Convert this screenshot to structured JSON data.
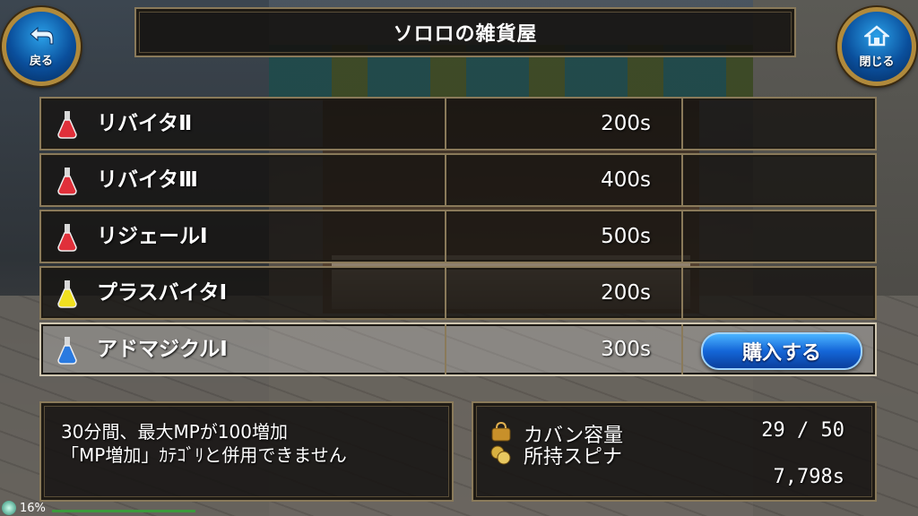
{
  "header": {
    "title": "ソロロの雑貨屋",
    "back_label": "戻る",
    "close_label": "閉じる"
  },
  "items": [
    {
      "name": "リバイタⅡ",
      "price": "200s",
      "potion_color": "#e0303a"
    },
    {
      "name": "リバイタⅢ",
      "price": "400s",
      "potion_color": "#e0303a"
    },
    {
      "name": "リジェールⅠ",
      "price": "500s",
      "potion_color": "#e0303a"
    },
    {
      "name": "プラスバイタⅠ",
      "price": "200s",
      "potion_color": "#f0e020"
    },
    {
      "name": "アドマジクルⅠ",
      "price": "300s",
      "potion_color": "#2a7ae0"
    }
  ],
  "buy_button": {
    "label": "購入する"
  },
  "description": {
    "line1": "30分間、最大MPが100増加",
    "line2": "「MP増加」ｶﾃｺﾞﾘと併用できません"
  },
  "stats": {
    "bag_label": "カバン容量",
    "bag_value": "29 / 50",
    "spina_label": "所持スピナ",
    "spina_value": "7,798s"
  },
  "status": {
    "percent": "16%"
  },
  "colors": {
    "accent_blue": "#1466d8",
    "frame_gold": "#8a7a5a"
  }
}
